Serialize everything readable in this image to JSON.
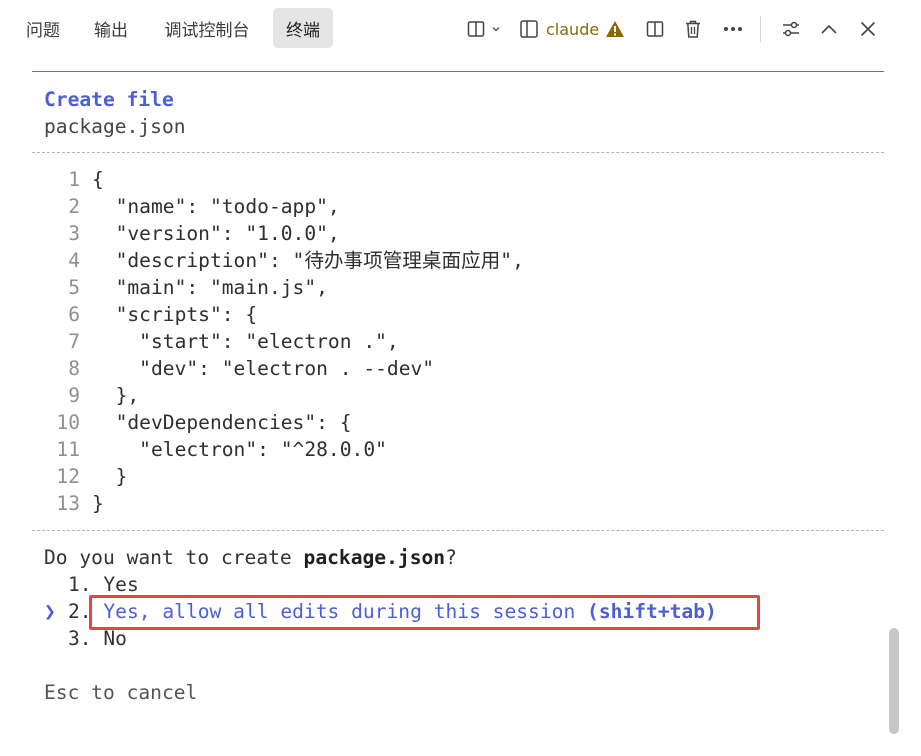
{
  "tabs": [
    {
      "label": "问题",
      "active": false
    },
    {
      "label": "输出",
      "active": false
    },
    {
      "label": "调试控制台",
      "active": false
    },
    {
      "label": "终端",
      "active": true
    }
  ],
  "toolbar": {
    "terminal_name": "claude",
    "icons": [
      "split-layout-icon",
      "chevron-down-icon",
      "terminal-panel-icon",
      "warning-icon",
      "split-editor-icon",
      "trash-icon",
      "more-icon",
      "settings-sliders-icon",
      "chevron-up-icon",
      "close-icon"
    ]
  },
  "terminal": {
    "header_title": "Create file",
    "header_file": "package.json",
    "code_lines": [
      {
        "num": "1",
        "text": "{"
      },
      {
        "num": "2",
        "text": "  \"name\": \"todo-app\","
      },
      {
        "num": "3",
        "text": "  \"version\": \"1.0.0\","
      },
      {
        "num": "4",
        "text": "  \"description\": \"待办事项管理桌面应用\","
      },
      {
        "num": "5",
        "text": "  \"main\": \"main.js\","
      },
      {
        "num": "6",
        "text": "  \"scripts\": {"
      },
      {
        "num": "7",
        "text": "    \"start\": \"electron .\","
      },
      {
        "num": "8",
        "text": "    \"dev\": \"electron . --dev\""
      },
      {
        "num": "9",
        "text": "  },"
      },
      {
        "num": "10",
        "text": "  \"devDependencies\": {"
      },
      {
        "num": "11",
        "text": "    \"electron\": \"^28.0.0\""
      },
      {
        "num": "12",
        "text": "  }"
      },
      {
        "num": "13",
        "text": "}"
      }
    ],
    "question_prefix": "Do you want to create ",
    "question_file": "package.json",
    "question_suffix": "?",
    "options": [
      {
        "marker": "",
        "num": "1.",
        "text": "Yes",
        "hint": "",
        "selected": false
      },
      {
        "marker": "❯",
        "num": "2.",
        "text": "Yes, allow all edits during this session",
        "hint": "(shift+tab)",
        "selected": true
      },
      {
        "marker": "",
        "num": "3.",
        "text": "No",
        "hint": "",
        "selected": false
      }
    ],
    "cancel_text": "Esc to cancel"
  },
  "colors": {
    "accent": "#4c5fd5",
    "highlight_box": "#e64545",
    "warning": "#8a6a00"
  }
}
